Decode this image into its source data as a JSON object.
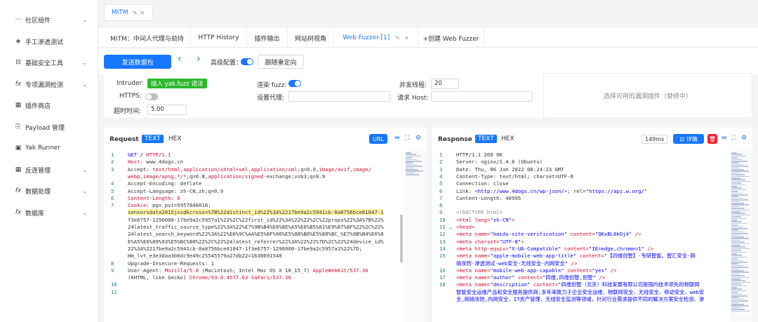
{
  "sidebar": {
    "items": [
      {
        "icon": "⋯",
        "icon_name": "ellipsis-icon",
        "label": "社区组件",
        "chevron": true
      },
      {
        "icon": "◈",
        "icon_name": "target-icon",
        "label": "手工渗透测试",
        "chevron": false
      },
      {
        "icon": "⊟",
        "icon_name": "toolbox-icon",
        "label": "基础安全工具",
        "chevron": true
      },
      {
        "icon": "fx",
        "icon_name": "function-icon",
        "label": "专项漏洞检测",
        "chevron": true
      },
      {
        "icon": "▦",
        "icon_name": "grid-icon",
        "label": "插件商店",
        "chevron": false
      },
      {
        "icon": "⎘",
        "icon_name": "file-icon",
        "label": "Payload 管理",
        "chevron": false
      },
      {
        "icon": "▣",
        "icon_name": "terminal-icon",
        "label": "Yak Runner",
        "chevron": false
      },
      {
        "icon": "▦",
        "icon_name": "grid-icon",
        "label": "反连管理",
        "chevron": true
      },
      {
        "icon": "fx",
        "icon_name": "function-icon",
        "label": "数据处理",
        "chevron": true
      },
      {
        "icon": "fx",
        "icon_name": "function-icon",
        "label": "数据库",
        "chevron": true
      }
    ]
  },
  "top_tab": {
    "label": "MITM",
    "edit_icon": "✎",
    "close_icon": "✕"
  },
  "sub_tabs": {
    "items": [
      {
        "label": "MITM：中间人代理与劫持",
        "active": false
      },
      {
        "label": "HTTP History",
        "active": false
      },
      {
        "label": "插件输出",
        "active": false
      },
      {
        "label": "网站树视角",
        "active": false
      },
      {
        "label": "Web Fuzzer-[1]",
        "active": true
      },
      {
        "label": "+创建 Web Fuzzer",
        "active": false
      }
    ]
  },
  "toolbar": {
    "send_label": "发送数据包",
    "prev_icon": "‹",
    "next_icon": "›",
    "advanced_label": "高级配置：",
    "advanced_on": true,
    "redirect_label": "跟随重定向"
  },
  "config": {
    "intruder_label": "Intruder:",
    "intruder_tag": "插入 yak.fuzz 语法",
    "render_fuzz_label": "渲染 fuzz:",
    "render_fuzz_on": true,
    "threads_label": "并发线程:",
    "threads_value": "20",
    "https_label": "HTTPS:",
    "https_on": false,
    "proxy_label": "设置代理:",
    "proxy_value": "",
    "host_label": "请求 Host:",
    "host_value": "",
    "timeout_label": "超时时间:",
    "timeout_value": "5.00"
  },
  "plugin_box": {
    "placeholder": "选择可用的漏洞插件（替修中）"
  },
  "request": {
    "title": "Request",
    "mode_text": "TEXT",
    "mode_hex": "HEX",
    "url_btn": "URL",
    "lines": [
      {
        "n": "1",
        "segs": [
          {
            "t": "GET / ",
            "c": "kw"
          },
          {
            "t": "HTTP/1.1",
            "c": "red"
          }
        ]
      },
      {
        "n": "2",
        "segs": [
          {
            "t": "Host: ",
            "c": "red"
          },
          {
            "t": "www.4dogs.cn",
            "c": ""
          }
        ]
      },
      {
        "n": "3",
        "segs": [
          {
            "t": "Accept: ",
            "c": ""
          },
          {
            "t": "text/html,application/xhtml+xml,application/xml",
            "c": "red"
          },
          {
            "t": ";q=0.9,",
            "c": ""
          },
          {
            "t": "image/avif,image/",
            "c": "red"
          }
        ]
      },
      {
        "n": "",
        "segs": [
          {
            "t": "webp,image/apng,*/*",
            "c": "red"
          },
          {
            "t": ";q=0.8,",
            "c": ""
          },
          {
            "t": "application/signed",
            "c": "red"
          },
          {
            "t": "-exchange;v=b3;q=0.9",
            "c": ""
          }
        ]
      },
      {
        "n": "4",
        "segs": [
          {
            "t": "Accept-Encoding: deflate",
            "c": ""
          }
        ]
      },
      {
        "n": "5",
        "segs": [
          {
            "t": "Accept-Language: zh-CN,zh;q=0.9",
            "c": ""
          }
        ]
      },
      {
        "n": "6",
        "segs": [
          {
            "t": "Content-Length: 0",
            "c": "red"
          }
        ]
      },
      {
        "n": "7",
        "segs": [
          {
            "t": "Cookie: ",
            "c": "red"
          },
          {
            "t": "pgv_pvi=5957846016;",
            "c": ""
          }
        ]
      },
      {
        "n": "",
        "segs": [
          {
            "t": "sensorsdata2015jssdkcross=%7B%22distinct_id%22%3A%2217be9a2c5941cb-0a8756bce61047-1",
            "c": "hl"
          }
        ]
      },
      {
        "n": "",
        "segs": [
          {
            "t": "f3e6757-1296000-17be9a2c5957a1%22%2C%22first_id%22%3A%22%22%2C%22props%22%3A%7B%22%",
            "c": ""
          }
        ]
      },
      {
        "n": "",
        "segs": [
          {
            "t": "24latest_traffic_source_type%22%3A%22%E7%9B%B4%E6%8E%A5%E6%B5%81%E9%87%8F%22%2C%22%",
            "c": ""
          }
        ]
      },
      {
        "n": "",
        "segs": [
          {
            "t": "24latest_search_keyword%22%3A%22%E6%9C%AA%E5%8F%96%E5%88%B0%E5%80%BC_%E7%9B%B4%E6%8",
            "c": ""
          }
        ]
      },
      {
        "n": "",
        "segs": [
          {
            "t": "E%A5%E6%89%93%E5%BC%80%22%2C%22%24latest_referrer%22%3A%22%22%7D%2C%22%24device_id%",
            "c": ""
          }
        ]
      },
      {
        "n": "",
        "segs": [
          {
            "t": "22%3A%2217be9a2c5941cb-0a8756bce61047-1f3e6757-1296000-17be9a2c5957a1%22%7D;",
            "c": ""
          }
        ]
      },
      {
        "n": "",
        "segs": [
          {
            "t": "Hm_lvt_e3e3daa3b6dc9e49c25545579a27db22=1638691548",
            "c": ""
          }
        ]
      },
      {
        "n": "8",
        "segs": [
          {
            "t": "Upgrade-Insecure-Requests: 1",
            "c": ""
          }
        ]
      },
      {
        "n": "9",
        "segs": [
          {
            "t": "User-Agent: ",
            "c": ""
          },
          {
            "t": "Mozilla/5.0",
            "c": "red"
          },
          {
            "t": " (Macintosh; Intel Mac OS X 10_15_7) ",
            "c": ""
          },
          {
            "t": "AppleWebKit/537.36",
            "c": "red"
          }
        ]
      },
      {
        "n": "",
        "segs": [
          {
            "t": "(KHTML, like Gecko) ",
            "c": ""
          },
          {
            "t": "Chrome/93.0.4577.63 Safari/537.36",
            "c": "red"
          }
        ]
      },
      {
        "n": "10",
        "segs": []
      },
      {
        "n": "11",
        "segs": []
      }
    ]
  },
  "response": {
    "title": "Response",
    "mode_text": "TEXT",
    "mode_hex": "HEX",
    "time": "149ms",
    "detail_btn": "详情",
    "lines": [
      {
        "n": "1",
        "segs": [
          {
            "t": "HTTP/1.1 200 OK",
            "c": ""
          }
        ]
      },
      {
        "n": "2",
        "segs": [
          {
            "t": "Server: nginx/1.4.6 (Ubuntu)",
            "c": ""
          }
        ]
      },
      {
        "n": "3",
        "segs": [
          {
            "t": "Date: Thu, 06 Jan 2022 08:24:23 GMT",
            "c": ""
          }
        ]
      },
      {
        "n": "4",
        "segs": [
          {
            "t": "Content-Type: text/html; charset=UTF-8",
            "c": ""
          }
        ]
      },
      {
        "n": "5",
        "segs": [
          {
            "t": "Connection: close",
            "c": ""
          }
        ]
      },
      {
        "n": "6",
        "segs": [
          {
            "t": "Link: <",
            "c": ""
          },
          {
            "t": "http://www.4dogs.cn/wp-json/",
            "c": "kw"
          },
          {
            "t": ">; rel=\"",
            "c": ""
          },
          {
            "t": "https://api.w.org/",
            "c": "kw"
          },
          {
            "t": "\"",
            "c": ""
          }
        ]
      },
      {
        "n": "7",
        "segs": [
          {
            "t": "Content-Length: 40995",
            "c": ""
          }
        ]
      },
      {
        "n": "8",
        "segs": []
      },
      {
        "n": "9",
        "segs": [
          {
            "t": "<!DOCTYPE html>",
            "c": "gray"
          }
        ]
      },
      {
        "n": "10",
        "segs": [
          {
            "t": "<html ",
            "c": "red"
          },
          {
            "t": "lang=",
            "c": "red"
          },
          {
            "t": "\"zh-CN\"",
            "c": "kw"
          },
          {
            "t": ">",
            "c": "red"
          }
        ]
      },
      {
        "n": "11",
        "segs": [
          {
            "t": "<head>",
            "c": "red"
          }
        ]
      },
      {
        "n": "12",
        "segs": [
          {
            "t": "   <meta ",
            "c": "red"
          },
          {
            "t": "name=",
            "c": "red"
          },
          {
            "t": "\"baidu-site-verification\" ",
            "c": "kw"
          },
          {
            "t": "content=",
            "c": "red"
          },
          {
            "t": "\"QKxBL6kOj4\"",
            "c": "kw"
          },
          {
            "t": " />",
            "c": "red"
          }
        ]
      },
      {
        "n": "13",
        "segs": [
          {
            "t": "   <meta ",
            "c": "red"
          },
          {
            "t": "charset=",
            "c": "red"
          },
          {
            "t": "\"UTF-8\"",
            "c": "kw"
          },
          {
            "t": ">",
            "c": "red"
          }
        ]
      },
      {
        "n": "14",
        "segs": [
          {
            "t": "   <meta ",
            "c": "red"
          },
          {
            "t": "http-equiv=",
            "c": "red"
          },
          {
            "t": "\"X-UA-Compatible\" ",
            "c": "kw"
          },
          {
            "t": "content=",
            "c": "red"
          },
          {
            "t": "\"IE=edge,chrome=1\"",
            "c": "kw"
          },
          {
            "t": " />",
            "c": "red"
          }
        ]
      },
      {
        "n": "15",
        "segs": [
          {
            "t": "   <meta ",
            "c": "red"
          },
          {
            "t": "name=",
            "c": "red"
          },
          {
            "t": "\"apple-mobile-web-app-title\" ",
            "c": "kw"
          },
          {
            "t": "content=",
            "c": "red"
          },
          {
            "t": "\"【四维创智】-专研智能，智汇安全-网",
            "c": "kw"
          }
        ]
      },
      {
        "n": "",
        "segs": [
          {
            "t": "络攻防-渗透测试-web安全-无线安全-内网安全\"",
            "c": "kw"
          },
          {
            "t": " />",
            "c": "red"
          }
        ]
      },
      {
        "n": "16",
        "segs": [
          {
            "t": "   <meta ",
            "c": "red"
          },
          {
            "t": "name=",
            "c": "red"
          },
          {
            "t": "\"mobile-web-app-capable\" ",
            "c": "kw"
          },
          {
            "t": "content=",
            "c": "red"
          },
          {
            "t": "\"yes\"",
            "c": "kw"
          },
          {
            "t": " />",
            "c": "red"
          }
        ]
      },
      {
        "n": "17",
        "segs": [
          {
            "t": "   <meta ",
            "c": "red"
          },
          {
            "t": "name=",
            "c": "red"
          },
          {
            "t": "\"author\" ",
            "c": "kw"
          },
          {
            "t": "content=",
            "c": "red"
          },
          {
            "t": "\"四维,四维创智,创智\"",
            "c": "kw"
          },
          {
            "t": " />",
            "c": "red"
          }
        ]
      },
      {
        "n": "18",
        "segs": [
          {
            "t": "   <meta ",
            "c": "red"
          },
          {
            "t": "name=",
            "c": "red"
          },
          {
            "t": "\"description\" ",
            "c": "kw"
          },
          {
            "t": "content=",
            "c": "red"
          },
          {
            "t": "\"四维创智（北京）科技发展有限公司是国内技术领先的物联网",
            "c": "kw"
          }
        ]
      },
      {
        "n": "",
        "segs": [
          {
            "t": "智能安全运维产品和安全服务提供商;多年来致力于企业安全运维、物联网安全、无线安全、移动安全、web安",
            "c": "kw"
          }
        ]
      },
      {
        "n": "",
        "segs": [
          {
            "t": "全,网络攻防,内网安全、IT资产管理、无线安全监测等领域，针对行业需求提供不同的解决方案安全检测、渗",
            "c": "kw"
          }
        ]
      }
    ]
  }
}
